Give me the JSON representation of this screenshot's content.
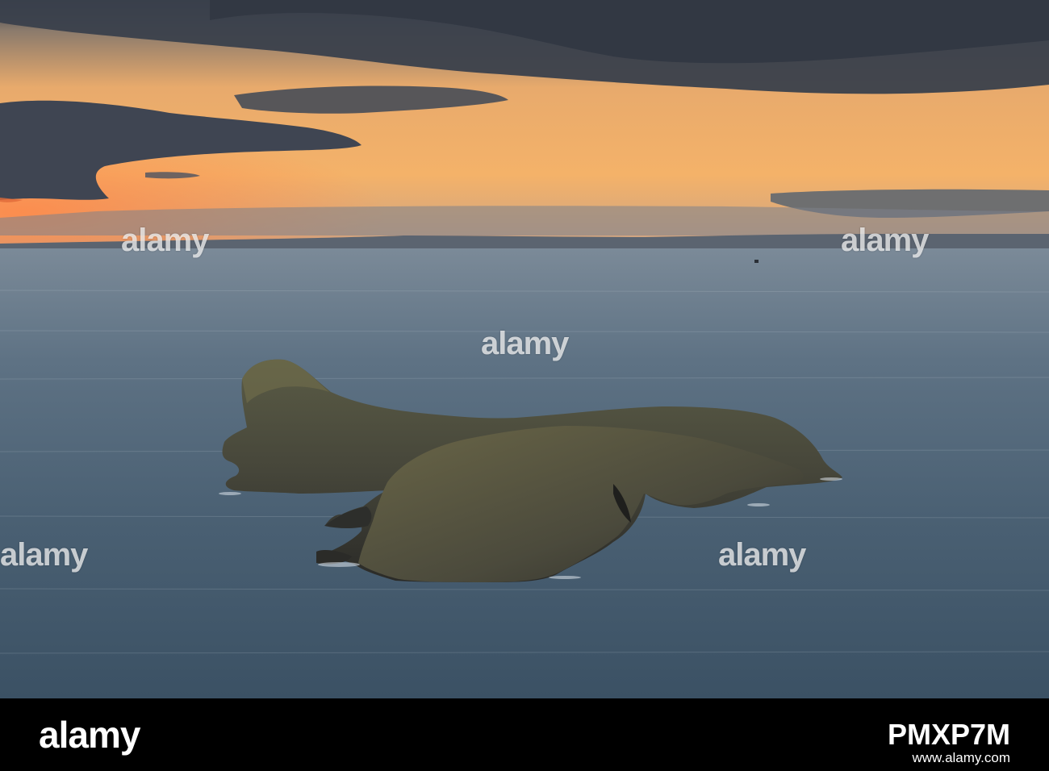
{
  "photo": {
    "sky_colors": [
      "#2f3744",
      "#6b6f76",
      "#f0b16e",
      "#f7b064",
      "#d9a070"
    ],
    "sea_colors": [
      "#6b7c8c",
      "#526779",
      "#3f5466",
      "#33495b"
    ],
    "island_colors": [
      "#3b3a33",
      "#4a4a3a",
      "#5b5a42",
      "#2a2a26"
    ]
  },
  "watermark": {
    "text": "alamy"
  },
  "footer": {
    "logo": "alamy",
    "image_id": "PMXP7M",
    "url": "www.alamy.com"
  }
}
